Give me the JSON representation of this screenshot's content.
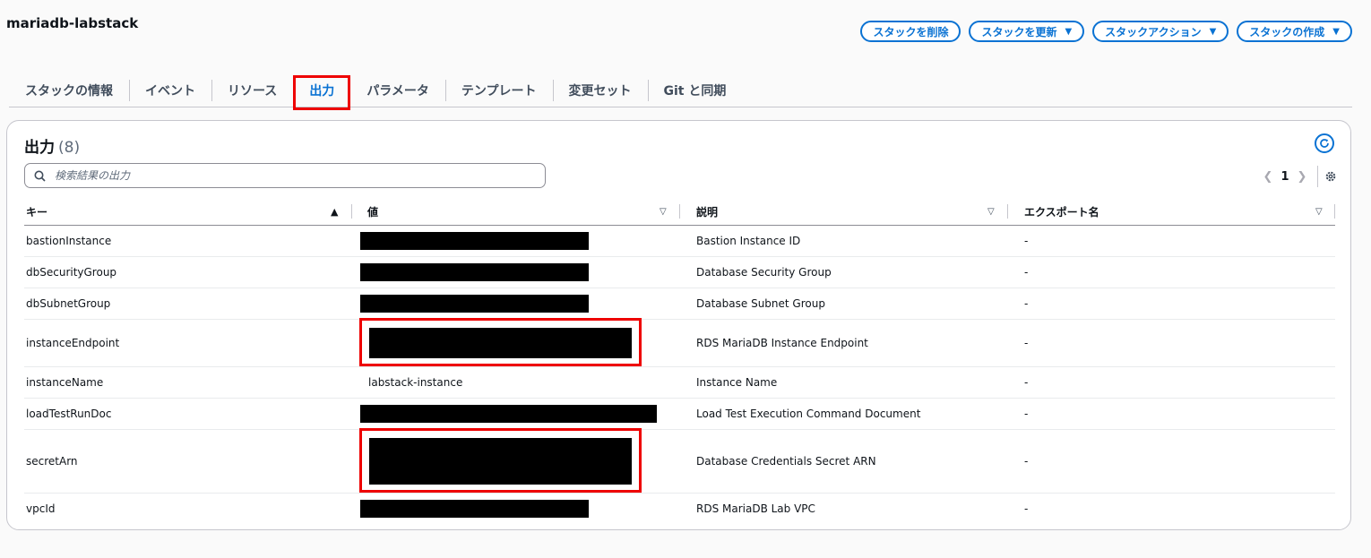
{
  "stack": {
    "name": "mariadb-labstack"
  },
  "actions": [
    {
      "label": "スタックを削除",
      "has_caret": false
    },
    {
      "label": "スタックを更新",
      "has_caret": true
    },
    {
      "label": "スタックアクション",
      "has_caret": true
    },
    {
      "label": "スタックの作成",
      "has_caret": true
    }
  ],
  "tabs": [
    {
      "label": "スタックの情報"
    },
    {
      "label": "イベント"
    },
    {
      "label": "リソース"
    },
    {
      "label": "出力",
      "active": true
    },
    {
      "label": "パラメータ"
    },
    {
      "label": "テンプレート"
    },
    {
      "label": "変更セット"
    },
    {
      "label": "Git と同期"
    }
  ],
  "outputs": {
    "title": "出力",
    "count": "(8)",
    "search_placeholder": "検索結果の出力",
    "page": "1",
    "columns": {
      "key": "キー",
      "value": "値",
      "description": "説明",
      "export": "エクスポート名"
    },
    "rows": [
      {
        "key": "bastionInstance",
        "value": null,
        "redacted": true,
        "description": "Bastion Instance ID",
        "export": "-"
      },
      {
        "key": "dbSecurityGroup",
        "value": null,
        "redacted": true,
        "description": "Database Security Group",
        "export": "-"
      },
      {
        "key": "dbSubnetGroup",
        "value": null,
        "redacted": true,
        "description": "Database Subnet Group",
        "export": "-"
      },
      {
        "key": "instanceEndpoint",
        "value": null,
        "redacted": true,
        "highlighted": true,
        "description": "RDS MariaDB Instance Endpoint",
        "export": "-"
      },
      {
        "key": "instanceName",
        "value": "labstack-instance",
        "redacted": false,
        "description": "Instance Name",
        "export": "-"
      },
      {
        "key": "loadTestRunDoc",
        "value": null,
        "redacted": true,
        "description": "Load Test Execution Command Document",
        "export": "-"
      },
      {
        "key": "secretArn",
        "value": null,
        "redacted": true,
        "highlighted": true,
        "description": "Database Credentials Secret ARN",
        "export": "-"
      },
      {
        "key": "vpcId",
        "value": null,
        "redacted": true,
        "description": "RDS MariaDB Lab VPC",
        "export": "-"
      }
    ]
  },
  "colors": {
    "accent": "#0972d3",
    "highlight": "#ee0000",
    "redaction": "#000000"
  },
  "icons": {
    "search": "search-icon",
    "refresh": "refresh-icon",
    "settings": "gear-icon",
    "sort": "sort-icon"
  }
}
